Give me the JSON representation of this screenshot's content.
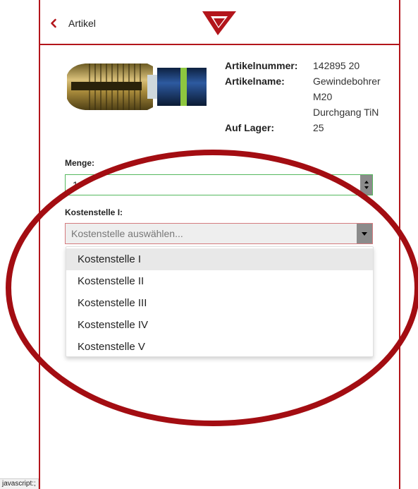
{
  "header": {
    "back_label": "Artikel",
    "accent_color": "#b3151b"
  },
  "product": {
    "image_icon": "thread-tap-image",
    "specs": [
      {
        "label": "Artikelnummer:",
        "value": "142895 20"
      },
      {
        "label": "Artikelname:",
        "value": "Gewindebohrer"
      },
      {
        "label": "",
        "value": "M20"
      },
      {
        "label": "",
        "value": "Durchgang TiN"
      },
      {
        "label": "Auf Lager:",
        "value": "25"
      }
    ]
  },
  "form": {
    "quantity_label": "Menge:",
    "quantity_value": "1",
    "cost_center_label": "Kostenstelle I:",
    "cost_center_placeholder": "Kostenstelle auswählen...",
    "options": [
      "Kostenstelle I",
      "Kostenstelle II",
      "Kostenstelle III",
      "Kostenstelle IV",
      "Kostenstelle V"
    ],
    "highlighted_option": "Kostenstelle I"
  },
  "status_bar": {
    "link_text": "javascript:;"
  }
}
